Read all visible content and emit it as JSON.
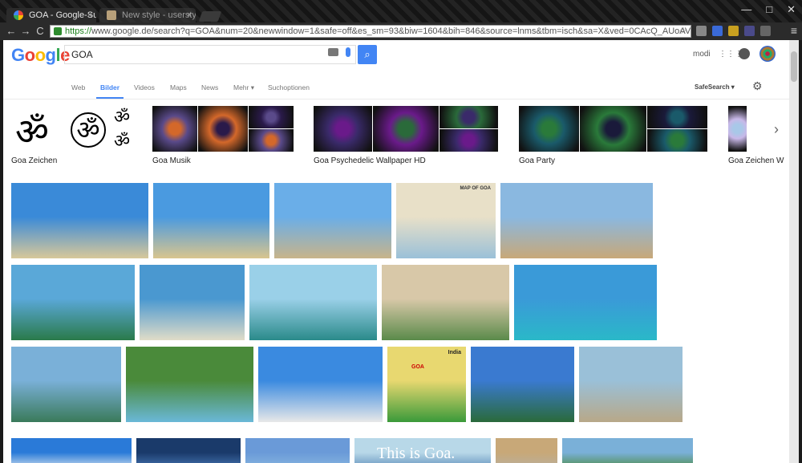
{
  "browser": {
    "tabs": [
      {
        "title": "GOA - Google-Suche",
        "close": "×"
      },
      {
        "title": "New style - userstyles.org",
        "close": "×"
      }
    ],
    "window_controls": [
      "—",
      "□",
      "✕"
    ],
    "nav_icons": [
      "←",
      "→",
      "C"
    ],
    "url_scheme": "https://",
    "url_rest": "www.google.de/search?q=GOA&num=20&newwindow=1&safe=off&es_sm=93&biw=1604&bih=846&source=lnms&tbm=isch&sa=X&ved=0CAcQ_AUoAV",
    "star": "☆",
    "menu": "≡"
  },
  "google": {
    "logo_letters": [
      {
        "ch": "G",
        "color": "#4285f4"
      },
      {
        "ch": "o",
        "color": "#ea4335"
      },
      {
        "ch": "o",
        "color": "#fbbc05"
      },
      {
        "ch": "g",
        "color": "#4285f4"
      },
      {
        "ch": "l",
        "color": "#34a853"
      },
      {
        "ch": "e",
        "color": "#ea4335"
      }
    ],
    "query": "GOA",
    "search_icon": "⌕",
    "user_name": "modi",
    "apps_icon": "⋮⋮⋮"
  },
  "nav": {
    "items": [
      "Web",
      "Bilder",
      "Videos",
      "Maps",
      "News",
      "Mehr ▾",
      "Suchoptionen"
    ],
    "active_index": 1,
    "safesearch": "SafeSearch ▾",
    "gear": "⚙"
  },
  "related": [
    {
      "label": "Goa Zeichen",
      "colors": [
        "#ffffff",
        "#ffffff",
        "#ffffff"
      ]
    },
    {
      "label": "Goa Musik",
      "colors": [
        "#5a4a8a",
        "#d4682a",
        "#2a1a4a"
      ]
    },
    {
      "label": "Goa Psychedelic Wallpaper HD",
      "colors": [
        "#3a2a6a",
        "#6a1a8a",
        "#2a6a3a"
      ]
    },
    {
      "label": "Goa Party",
      "colors": [
        "#1a5a6a",
        "#2a7a3a",
        "#1a1a3a"
      ]
    },
    {
      "label": "Goa Zeichen W",
      "colors": [
        "#c8b8e8",
        "#a8c8e8",
        "#e0e0e0"
      ]
    }
  ],
  "om_symbol": "ॐ",
  "arrow_icon": "›",
  "image_rows": [
    [
      {
        "w": 171,
        "c1": "#3a8ad8",
        "c2": "#d8c89a"
      },
      {
        "w": 145,
        "c1": "#4a9ae0",
        "c2": "#d9c58e"
      },
      {
        "w": 146,
        "c1": "#6aaee8",
        "c2": "#c8b48a"
      },
      {
        "w": 124,
        "c1": "#e8e0c8",
        "c2": "#9ac0d8"
      },
      {
        "w": 190,
        "c1": "#8ab8e0",
        "c2": "#c8a878"
      }
    ],
    [
      {
        "w": 154,
        "c1": "#5aa8d8",
        "c2": "#2a7a4a"
      },
      {
        "w": 131,
        "c1": "#4a98d0",
        "c2": "#e0dcc8"
      },
      {
        "w": 159,
        "c1": "#9ad0e8",
        "c2": "#2a8a8a"
      },
      {
        "w": 159,
        "c1": "#d8c8a8",
        "c2": "#5a8a4a"
      },
      {
        "w": 178,
        "c1": "#3a9ad8",
        "c2": "#2ab8c8"
      }
    ],
    [
      {
        "w": 137,
        "c1": "#7ab0d8",
        "c2": "#3a7a5a"
      },
      {
        "w": 159,
        "c1": "#4a8a3a",
        "c2": "#6ab8d8"
      },
      {
        "w": 155,
        "c1": "#3a8ae0",
        "c2": "#e8e8e8"
      },
      {
        "w": 98,
        "c1": "#e8d870",
        "c2": "#3a9a3a"
      },
      {
        "w": 129,
        "c1": "#3a7ad0",
        "c2": "#2a6a3a"
      },
      {
        "w": 129,
        "c1": "#9ac0d8",
        "c2": "#b8a888"
      }
    ],
    [
      {
        "w": 150,
        "c1": "#2a7ad8",
        "c2": "#dde8f0"
      },
      {
        "w": 130,
        "c1": "#1a3a6a",
        "c2": "#4a7ab8"
      },
      {
        "w": 130,
        "c1": "#6a9ad8",
        "c2": "#8ab8e0"
      },
      {
        "w": 170,
        "c1": "#b8d8e8",
        "c2": "#5a8ab8"
      },
      {
        "w": 77,
        "c1": "#c8a878",
        "c2": "#b8b0a0"
      },
      {
        "w": 163,
        "c1": "#7ab0d8",
        "c2": "#4a8a3a"
      }
    ]
  ],
  "map_title": "MAP OF GOA",
  "map_india": "India",
  "map_goa": "GOA",
  "bottom_text": "This is Goa."
}
